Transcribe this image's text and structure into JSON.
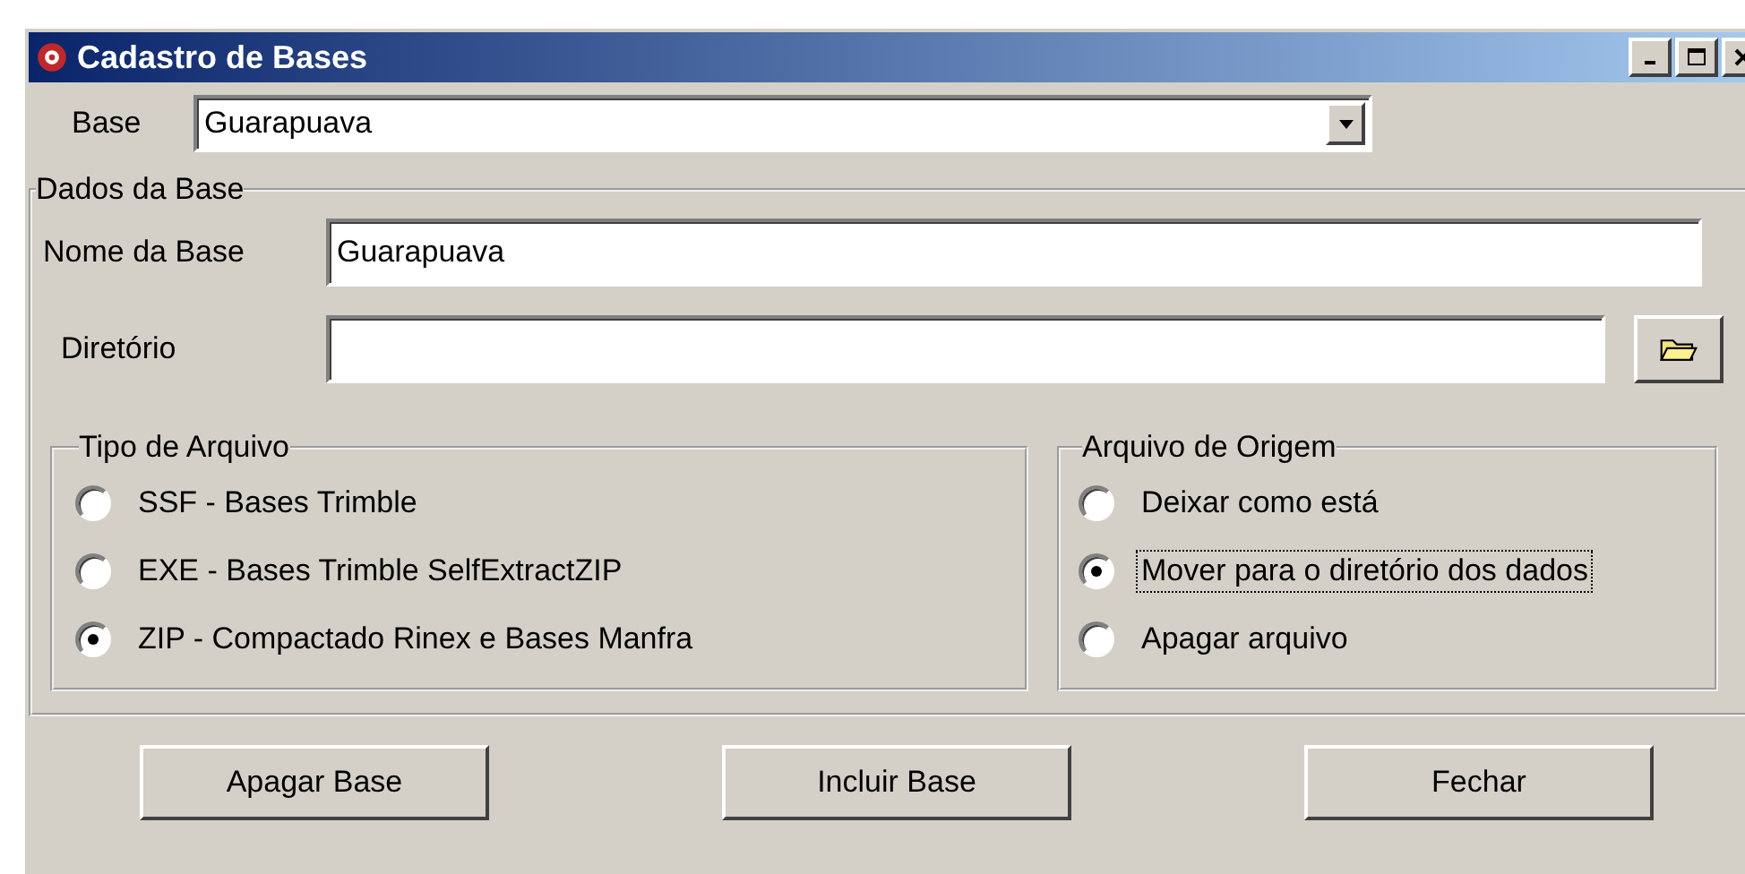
{
  "window": {
    "title": "Cadastro de Bases"
  },
  "base": {
    "label": "Base",
    "value": "Guarapuava"
  },
  "dados": {
    "title": "Dados da Base",
    "nome": {
      "label": "Nome da Base",
      "value": "Guarapuava"
    },
    "diretorio": {
      "label": "Diretório"
    }
  },
  "tipo_arquivo": {
    "title": "Tipo de Arquivo",
    "options": [
      {
        "label": "SSF - Bases Trimble",
        "selected": false,
        "focused": false
      },
      {
        "label": "EXE - Bases Trimble SelfExtractZIP",
        "selected": false,
        "focused": false
      },
      {
        "label": "ZIP - Compactado Rinex e Bases Manfra",
        "selected": true,
        "focused": false
      }
    ]
  },
  "arquivo_origem": {
    "title": "Arquivo de Origem",
    "options": [
      {
        "label": "Deixar como está",
        "selected": false,
        "focused": false
      },
      {
        "label": "Mover para o diretório dos dados",
        "selected": true,
        "focused": true
      },
      {
        "label": "Apagar arquivo",
        "selected": false,
        "focused": false
      }
    ]
  },
  "buttons": [
    "Apagar Base",
    "Incluir Base",
    "Fechar"
  ]
}
